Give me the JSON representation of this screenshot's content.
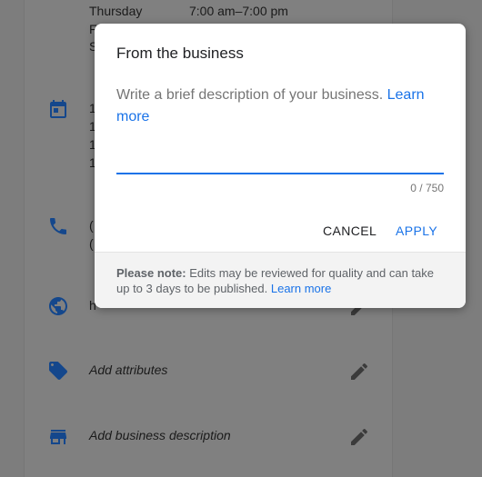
{
  "background": {
    "hours_day": "Thursday",
    "hours_time": "7:00 am–7:00 pm",
    "partial_line_1": "F",
    "partial_line_2": "S",
    "special_hours_lines": [
      "1",
      "1",
      "1",
      "1"
    ],
    "phone_lines": [
      "(",
      "("
    ],
    "website_partial": "h",
    "attributes_label": "Add attributes",
    "business_description_label": "Add business description"
  },
  "dialog": {
    "title": "From the business",
    "description_text": "Write a brief description of your business. ",
    "learn_more_link": "Learn more",
    "input_value": "",
    "counter": "0 / 750",
    "cancel_label": "CANCEL",
    "apply_label": "APPLY",
    "note_label": "Please note:",
    "note_text": " Edits may be reviewed for quality and can take up to 3 days to be published. ",
    "note_link": "Learn more"
  },
  "colors": {
    "accent": "#1a73e8",
    "icon_blue": "#14478c",
    "overlay": "#808080"
  }
}
